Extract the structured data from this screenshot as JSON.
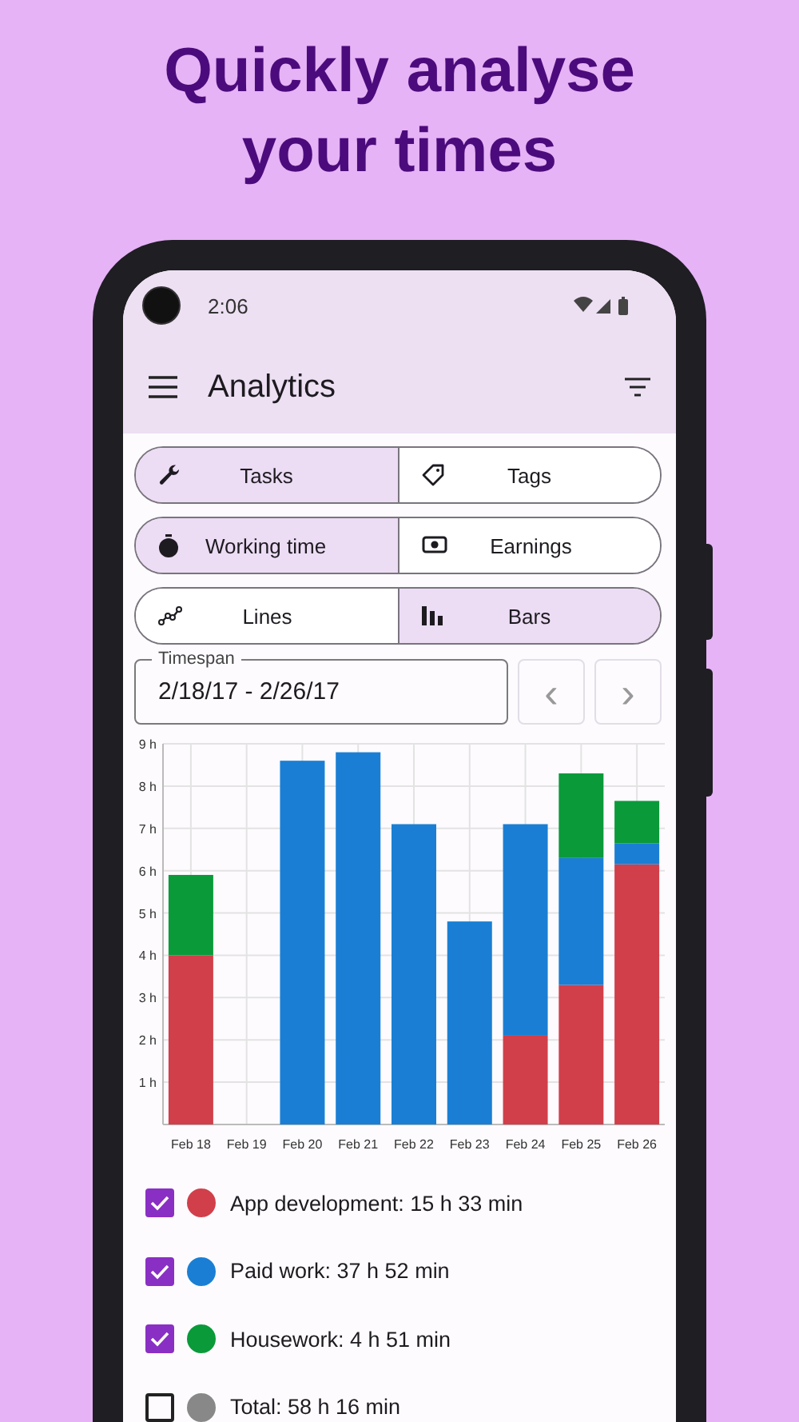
{
  "headline": "Quickly analyse your times",
  "status_bar": {
    "time": "2:06"
  },
  "app_bar": {
    "title": "Analytics"
  },
  "toggle_groups": [
    [
      {
        "label": "Tasks",
        "selected": true
      },
      {
        "label": "Tags",
        "selected": false
      }
    ],
    [
      {
        "label": "Working time",
        "selected": true
      },
      {
        "label": "Earnings",
        "selected": false
      }
    ],
    [
      {
        "label": "Lines",
        "selected": false
      },
      {
        "label": "Bars",
        "selected": true
      }
    ]
  ],
  "timespan": {
    "label": "Timespan",
    "value": "2/18/17 - 2/26/17",
    "prev": "‹",
    "next": "›"
  },
  "chart_data": {
    "type": "bar",
    "stacked": true,
    "categories": [
      "Feb 18",
      "Feb 19",
      "Feb 20",
      "Feb 21",
      "Feb 22",
      "Feb 23",
      "Feb 24",
      "Feb 25",
      "Feb 26"
    ],
    "series": [
      {
        "color": "#d13f4a",
        "values": [
          4.0,
          0,
          0,
          0,
          0,
          0,
          2.1,
          3.3,
          6.15
        ]
      },
      {
        "color": "#1a7fd4",
        "values": [
          0,
          0,
          8.6,
          8.8,
          7.1,
          4.8,
          5.0,
          3.0,
          0.5
        ]
      },
      {
        "color": "#0a9a3a",
        "values": [
          1.9,
          0,
          0,
          0,
          0,
          0,
          0,
          2.0,
          1.0
        ]
      }
    ],
    "ylim": [
      0,
      9
    ],
    "grid": true,
    "yticks": [
      {
        "value": 1,
        "label": "1 h"
      },
      {
        "value": 2,
        "label": "2 h"
      },
      {
        "value": 3,
        "label": "3 h"
      },
      {
        "value": 4,
        "label": "4 h"
      },
      {
        "value": 5,
        "label": "5 h"
      },
      {
        "value": 6,
        "label": "6 h"
      },
      {
        "value": 7,
        "label": "7 h"
      },
      {
        "value": 8,
        "label": "8 h"
      },
      {
        "value": 9,
        "label": "9 h"
      }
    ]
  },
  "legend": [
    {
      "label": "App development: 15 h 33 min",
      "checked": true,
      "color": "#d13f4a"
    },
    {
      "label": "Paid work: 37 h 52 min",
      "checked": true,
      "color": "#1a7fd4"
    },
    {
      "label": "Housework: 4 h 51 min",
      "checked": true,
      "color": "#0a9a3a"
    },
    {
      "label": "Total: 58 h 16 min",
      "checked": false,
      "color": "#888888"
    }
  ]
}
